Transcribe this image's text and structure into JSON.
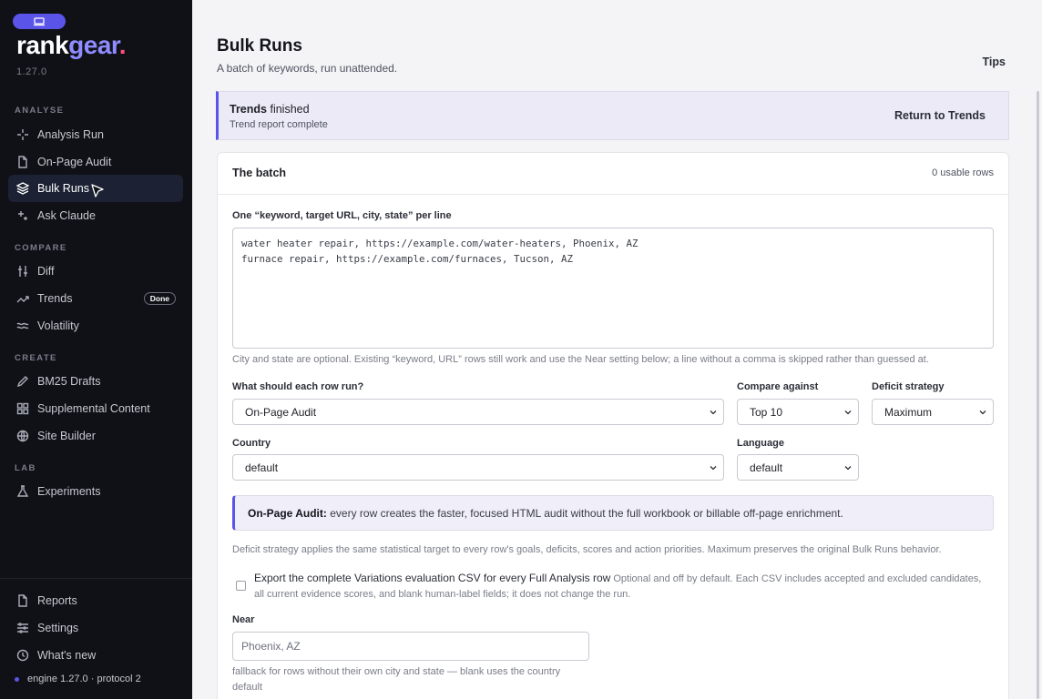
{
  "sidebar": {
    "brand_main": "rank",
    "brand_accent": "gear",
    "brand_dot": ".",
    "version": "1.27.0",
    "sections": {
      "analyse": "ANALYSE",
      "compare": "COMPARE",
      "create": "CREATE",
      "lab": "LAB"
    },
    "items": {
      "analysis_run": "Analysis Run",
      "on_page_audit": "On-Page Audit",
      "bulk_runs": "Bulk Runs",
      "ask_claude": "Ask Claude",
      "diff": "Diff",
      "trends": "Trends",
      "trends_badge": "Done",
      "volatility": "Volatility",
      "bm25_drafts": "BM25 Drafts",
      "supplemental_content": "Supplemental Content",
      "site_builder": "Site Builder",
      "experiments": "Experiments",
      "reports": "Reports",
      "settings": "Settings",
      "whats_new": "What's new"
    },
    "engine": "engine 1.27.0 · protocol 2"
  },
  "header": {
    "title": "Bulk Runs",
    "subtitle": "A batch of keywords, run unattended.",
    "tips": "Tips"
  },
  "notice": {
    "strong": "Trends",
    "rest": " finished",
    "sub": "Trend report complete",
    "action": "Return to Trends"
  },
  "batch": {
    "title": "The batch",
    "usable_rows": "0 usable rows",
    "input_label": "One “keyword, target URL, city, state” per line",
    "input_value": "water heater repair, https://example.com/water-heaters, Phoenix, AZ\nfurnace repair, https://example.com/furnaces, Tucson, AZ",
    "input_help": "City and state are optional. Existing “keyword, URL” rows still work and use the Near setting below; a line without a comma is skipped rather than guessed at.",
    "row_run_label": "What should each row run?",
    "row_run_value": "On-Page Audit",
    "compare_label": "Compare against",
    "compare_value": "Top 10",
    "deficit_label": "Deficit strategy",
    "deficit_value": "Maximum",
    "country_label": "Country",
    "country_value": "default",
    "language_label": "Language",
    "language_value": "default",
    "info_strong": "On-Page Audit:",
    "info_rest": " every row creates the faster, focused HTML audit without the full workbook or billable off-page enrichment.",
    "deficit_help": "Deficit strategy applies the same statistical target to every row's goals, deficits, scores and action priorities. Maximum preserves the original Bulk Runs behavior.",
    "export_label": "Export the complete Variations evaluation CSV for every Full Analysis row",
    "export_help": " Optional and off by default. Each CSV includes accepted and excluded candidates, all current evidence scores, and blank human-label fields; it does not change the run.",
    "near_label": "Near",
    "near_placeholder": "Phoenix, AZ",
    "near_help": "fallback for rows without their own city and state — blank uses the country default"
  }
}
